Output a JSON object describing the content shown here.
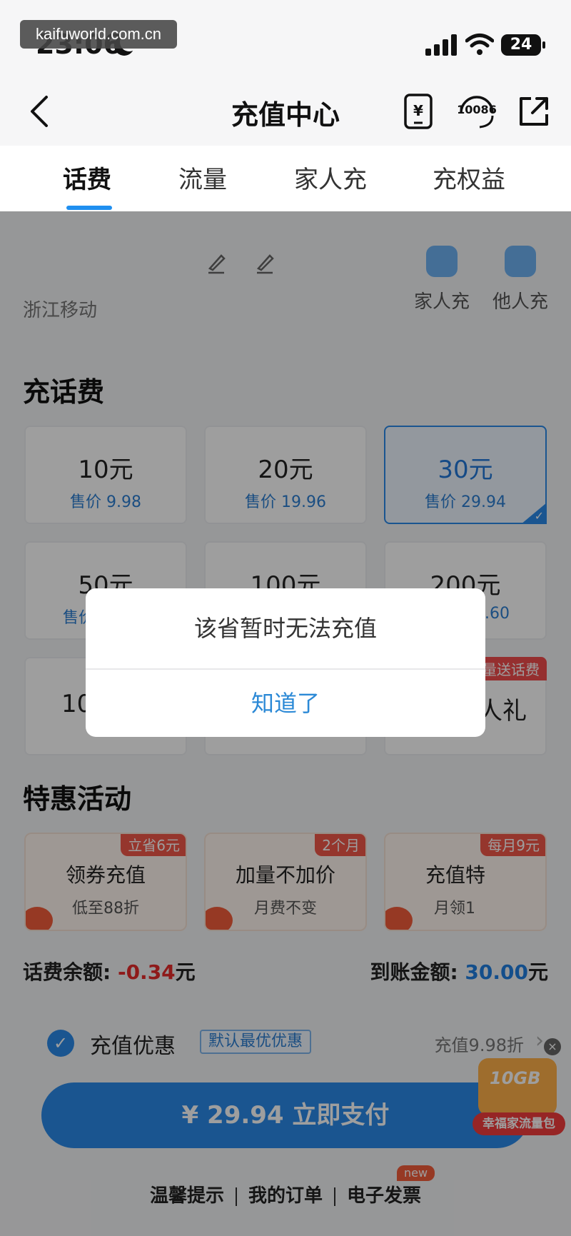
{
  "watermark": "kaifuworld.com.cn",
  "status_bar": {
    "time": "23:06",
    "battery": "24"
  },
  "nav": {
    "title": "充值中心",
    "service_icon_label": "10086"
  },
  "tabs": [
    {
      "label": "话费",
      "active": true
    },
    {
      "label": "流量",
      "active": false
    },
    {
      "label": "家人充",
      "active": false
    },
    {
      "label": "充权益",
      "active": false
    }
  ],
  "account": {
    "carrier": "浙江移动",
    "quick_actions": [
      {
        "label": "家人充"
      },
      {
        "label": "他人充"
      }
    ]
  },
  "recharge": {
    "title": "充话费",
    "options": [
      {
        "amount": "10元",
        "price": "售价 9.98",
        "selected": false
      },
      {
        "amount": "20元",
        "price": "售价 19.96",
        "selected": false
      },
      {
        "amount": "30元",
        "price": "售价 29.94",
        "selected": true
      },
      {
        "amount": "50元",
        "price": "售价",
        "selected": false
      },
      {
        "amount": "100元",
        "price": "",
        "selected": false
      },
      {
        "amount": "200元",
        "price": ".60",
        "selected": false
      },
      {
        "amount": "10",
        "price": "",
        "selected": false
      },
      {
        "amount": "",
        "price": "",
        "selected": false
      },
      {
        "amount": "人礼",
        "price": "",
        "ribbon": "量送话费",
        "selected": false
      }
    ]
  },
  "promotions": {
    "title": "特惠活动",
    "items": [
      {
        "tag": "立省6元",
        "title": "领券充值",
        "subtitle": "低至88折"
      },
      {
        "tag": "2个月",
        "title": "加量不加价",
        "subtitle": "月费不变"
      },
      {
        "tag": "每月9元",
        "title": "充值特",
        "subtitle": "月领1"
      }
    ]
  },
  "balance": {
    "label": "话费余额:",
    "value": "-0.34",
    "unit": "元",
    "arrive_label": "到账金额:",
    "arrive_value": "30.00",
    "arrive_unit": "元"
  },
  "discount": {
    "label": "充值优惠",
    "badge": "默认最优优惠",
    "right_text": "充值9.98折"
  },
  "pay_button": {
    "label": "¥ 29.94  立即支付"
  },
  "footer": {
    "links": [
      "温馨提示",
      "我的订单",
      "电子发票"
    ],
    "new_badge": "new"
  },
  "float_ad": {
    "gb": "10GB",
    "label": "幸福家流量包"
  },
  "dialog": {
    "message": "该省暂时无法充值",
    "confirm": "知道了"
  },
  "colors": {
    "accent": "#2b8ae8",
    "negative": "#e62b2b",
    "promo_red": "#f0574a"
  }
}
